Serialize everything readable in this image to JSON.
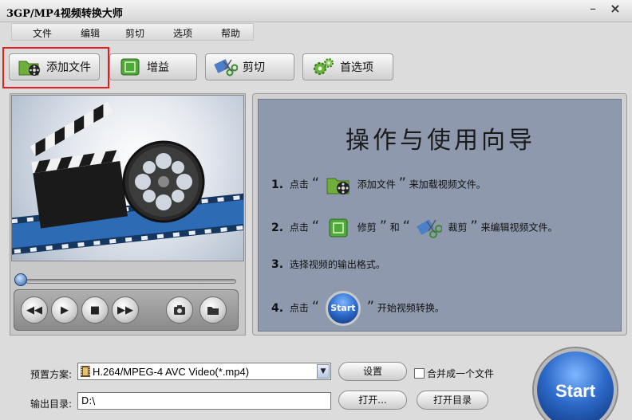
{
  "window": {
    "title": "3GP/MP4视频转换大师",
    "minimize": "–",
    "close": "×"
  },
  "menu": {
    "items": [
      "文件",
      "编辑",
      "剪切",
      "选项",
      "帮助"
    ]
  },
  "toolbar": {
    "add_file": "添加文件",
    "enhance": "增益",
    "cut": "剪切",
    "preferences": "首选项"
  },
  "guide": {
    "title": "操作与使用向导",
    "step1": {
      "num": "1.",
      "pre": "点击",
      "label": "添加文件",
      "post": "来加载视频文件。"
    },
    "step2": {
      "num": "2.",
      "pre": "点击",
      "label_a": "修剪",
      "and": "和",
      "label_b": "裁剪",
      "post": "来编辑视频文件。"
    },
    "step3": {
      "num": "3.",
      "text": "选择视频的输出格式。"
    },
    "step4": {
      "num": "4.",
      "pre": "点击",
      "start": "Start",
      "post": "开始视频转换。"
    },
    "quote_open": "“",
    "quote_close": "”"
  },
  "bottom": {
    "preset_label": "预置方案:",
    "preset_value": "H.264/MPEG-4 AVC Video(*.mp4)",
    "settings_button": "设置",
    "merge_label": "合并成一个文件",
    "outdir_label": "输出目录:",
    "outdir_value": "D:\\",
    "open_button": "打开...",
    "open_dir_button": "打开目录",
    "start_button": "Start"
  },
  "colors": {
    "guide_bg": "#8e99ad",
    "start_blue": "#2d6ac9",
    "highlight_red": "#e22020"
  },
  "icons": {
    "add_file": "folder-reel-icon",
    "enhance": "green-square-icon",
    "cut": "scissors-film-icon",
    "preferences": "gears-icon"
  }
}
